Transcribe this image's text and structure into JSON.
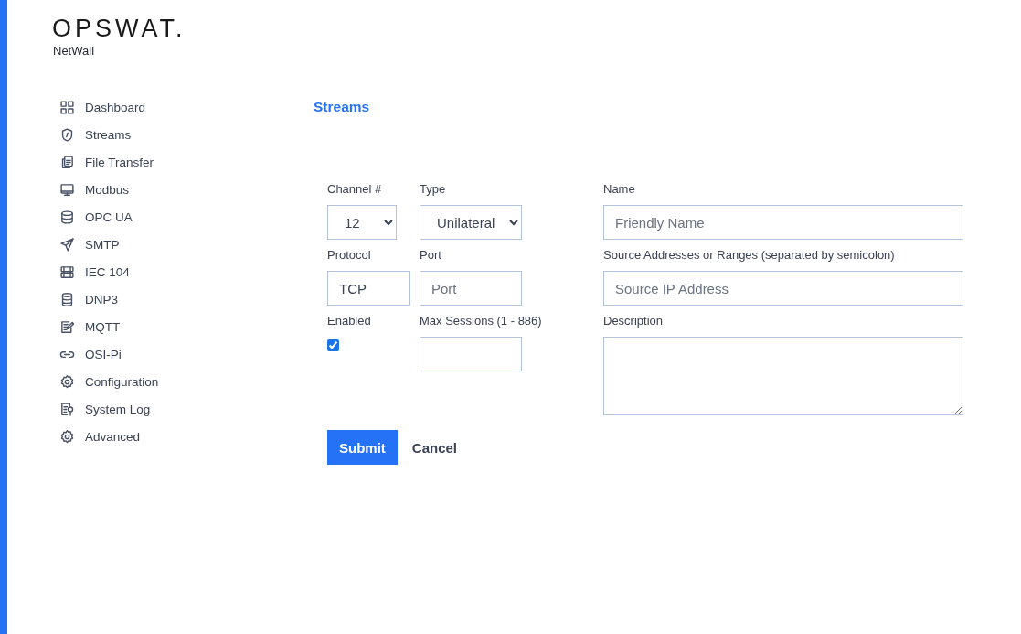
{
  "brand": {
    "logo": "OPSWAT.",
    "product": "NetWall"
  },
  "sidebar": {
    "items": [
      {
        "label": "Dashboard"
      },
      {
        "label": "Streams"
      },
      {
        "label": "File Transfer"
      },
      {
        "label": "Modbus"
      },
      {
        "label": "OPC UA"
      },
      {
        "label": "SMTP"
      },
      {
        "label": "IEC 104"
      },
      {
        "label": "DNP3"
      },
      {
        "label": "MQTT"
      },
      {
        "label": "OSI-Pi"
      },
      {
        "label": "Configuration"
      },
      {
        "label": "System Log"
      },
      {
        "label": "Advanced"
      }
    ]
  },
  "page_title": "Streams",
  "form": {
    "fields": [
      {
        "kind": "select",
        "label": "Channel #",
        "value": "12"
      },
      {
        "kind": "select",
        "label": "Type",
        "value": "Unilateral"
      },
      {
        "kind": "input",
        "label": "Name",
        "placeholder": "Friendly Name"
      },
      {
        "kind": "input",
        "label": "Protocol",
        "value": "TCP"
      },
      {
        "kind": "input",
        "label": "Port",
        "placeholder": "Port"
      },
      {
        "kind": "input",
        "label": "Source Addresses or Ranges (separated by semicolon)",
        "placeholder": "Source IP Address"
      },
      {
        "kind": "checkbox",
        "label": "Enabled",
        "checked": true
      },
      {
        "kind": "input",
        "label": "Max Sessions (1 - 886)"
      },
      {
        "kind": "textarea",
        "label": "Description"
      }
    ],
    "buttons": [
      {
        "label": "Submit",
        "kind": "primary"
      },
      {
        "label": "Cancel",
        "kind": "plain"
      }
    ]
  }
}
